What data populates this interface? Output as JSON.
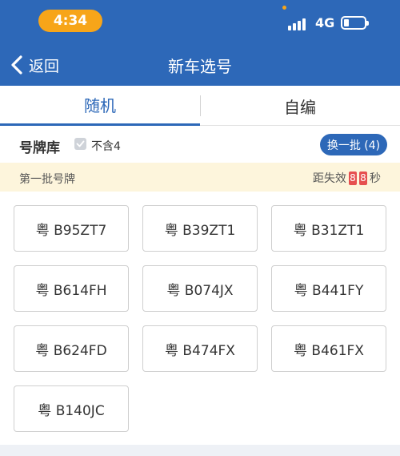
{
  "status_bar": {
    "time": "4:34",
    "network": "4G",
    "icons": [
      "signal-icon",
      "battery-icon"
    ]
  },
  "nav": {
    "back_label": "返回",
    "title": "新车选号",
    "back_icon": "chevron-left-icon"
  },
  "tabs": [
    {
      "label": "随机",
      "active": true
    },
    {
      "label": "自编",
      "active": false
    }
  ],
  "pool": {
    "label": "号牌库",
    "exclude_label": "不含4",
    "exclude_checked": true,
    "swap_label": "换一批 (4)"
  },
  "batch": {
    "title": "第一批号牌",
    "expiry_label": "距失效",
    "expiry_digits": [
      "8",
      "8"
    ],
    "expiry_unit": "秒"
  },
  "plates": [
    "粤 B95ZT7",
    "粤 B39ZT1",
    "粤 B31ZT1",
    "粤 B614FH",
    "粤 B074JX",
    "粤 B441FY",
    "粤 B624FD",
    "粤 B474FX",
    "粤 B461FX",
    "粤 B140JC"
  ],
  "colors": {
    "primary": "#2d68b8",
    "accent": "#f7a519",
    "countdown": "#e65050",
    "banner": "#fdf5dc"
  }
}
